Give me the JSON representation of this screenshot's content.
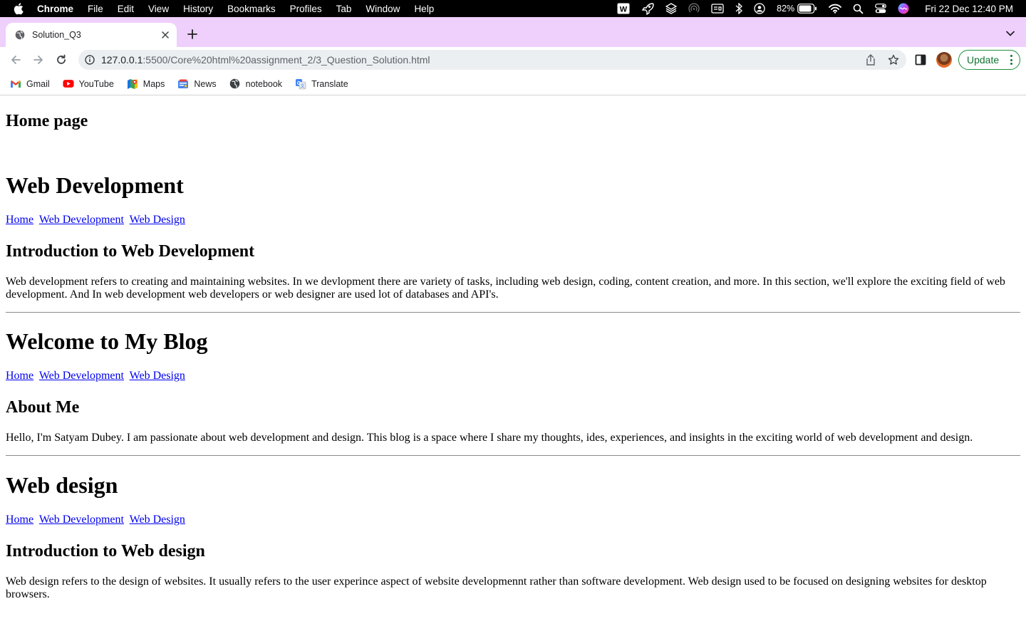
{
  "menubar": {
    "app_name": "Chrome",
    "items": [
      "File",
      "Edit",
      "View",
      "History",
      "Bookmarks",
      "Profiles",
      "Tab",
      "Window",
      "Help"
    ],
    "battery": "82%",
    "datetime": "Fri 22 Dec  12:40 PM"
  },
  "tab": {
    "title": "Solution_Q3"
  },
  "toolbar": {
    "url_host": "127.0.0.1",
    "url_path": ":5500/Core%20html%20assignment_2/3_Question_Solution.html",
    "update_label": "Update"
  },
  "bookmarks": [
    {
      "label": "Gmail",
      "icon": "gmail-icon"
    },
    {
      "label": "YouTube",
      "icon": "youtube-icon"
    },
    {
      "label": "Maps",
      "icon": "maps-icon"
    },
    {
      "label": "News",
      "icon": "news-icon"
    },
    {
      "label": "notebook",
      "icon": "globe-icon"
    },
    {
      "label": "Translate",
      "icon": "translate-icon"
    }
  ],
  "page": {
    "home_heading": "Home page",
    "sections": [
      {
        "title": "Web Development",
        "nav": [
          "Home",
          "Web Development",
          "Web Design"
        ],
        "subtitle": "Introduction to Web Development",
        "paragraph": "Web development refers to creating and maintaining websites. In we devlopment there are variety of tasks, including web design, coding, content creation, and more. In this section, we'll explore the exciting field of web development. And In web development web developers or web designer are used lot of databases and API's."
      },
      {
        "title": "Welcome to My Blog",
        "nav": [
          "Home",
          "Web Development",
          "Web Design"
        ],
        "subtitle": "About Me",
        "paragraph": "Hello, I'm Satyam Dubey. I am passionate about web development and design. This blog is a space where I share my thoughts, ides, experiences, and insights in the exciting world of web development and design."
      },
      {
        "title": "Web design",
        "nav": [
          "Home",
          "Web Development",
          "Web Design"
        ],
        "subtitle": "Introduction to Web design",
        "paragraph": "Web design refers to the design of websites. It usually refers to the user experince aspect of website developmennt rather than software development. Web design used to be focused on designing websites for desktop browsers."
      }
    ]
  },
  "colors": {
    "tabstrip": "#efcffb",
    "link": "#0000ee",
    "update_green": "#137333"
  }
}
